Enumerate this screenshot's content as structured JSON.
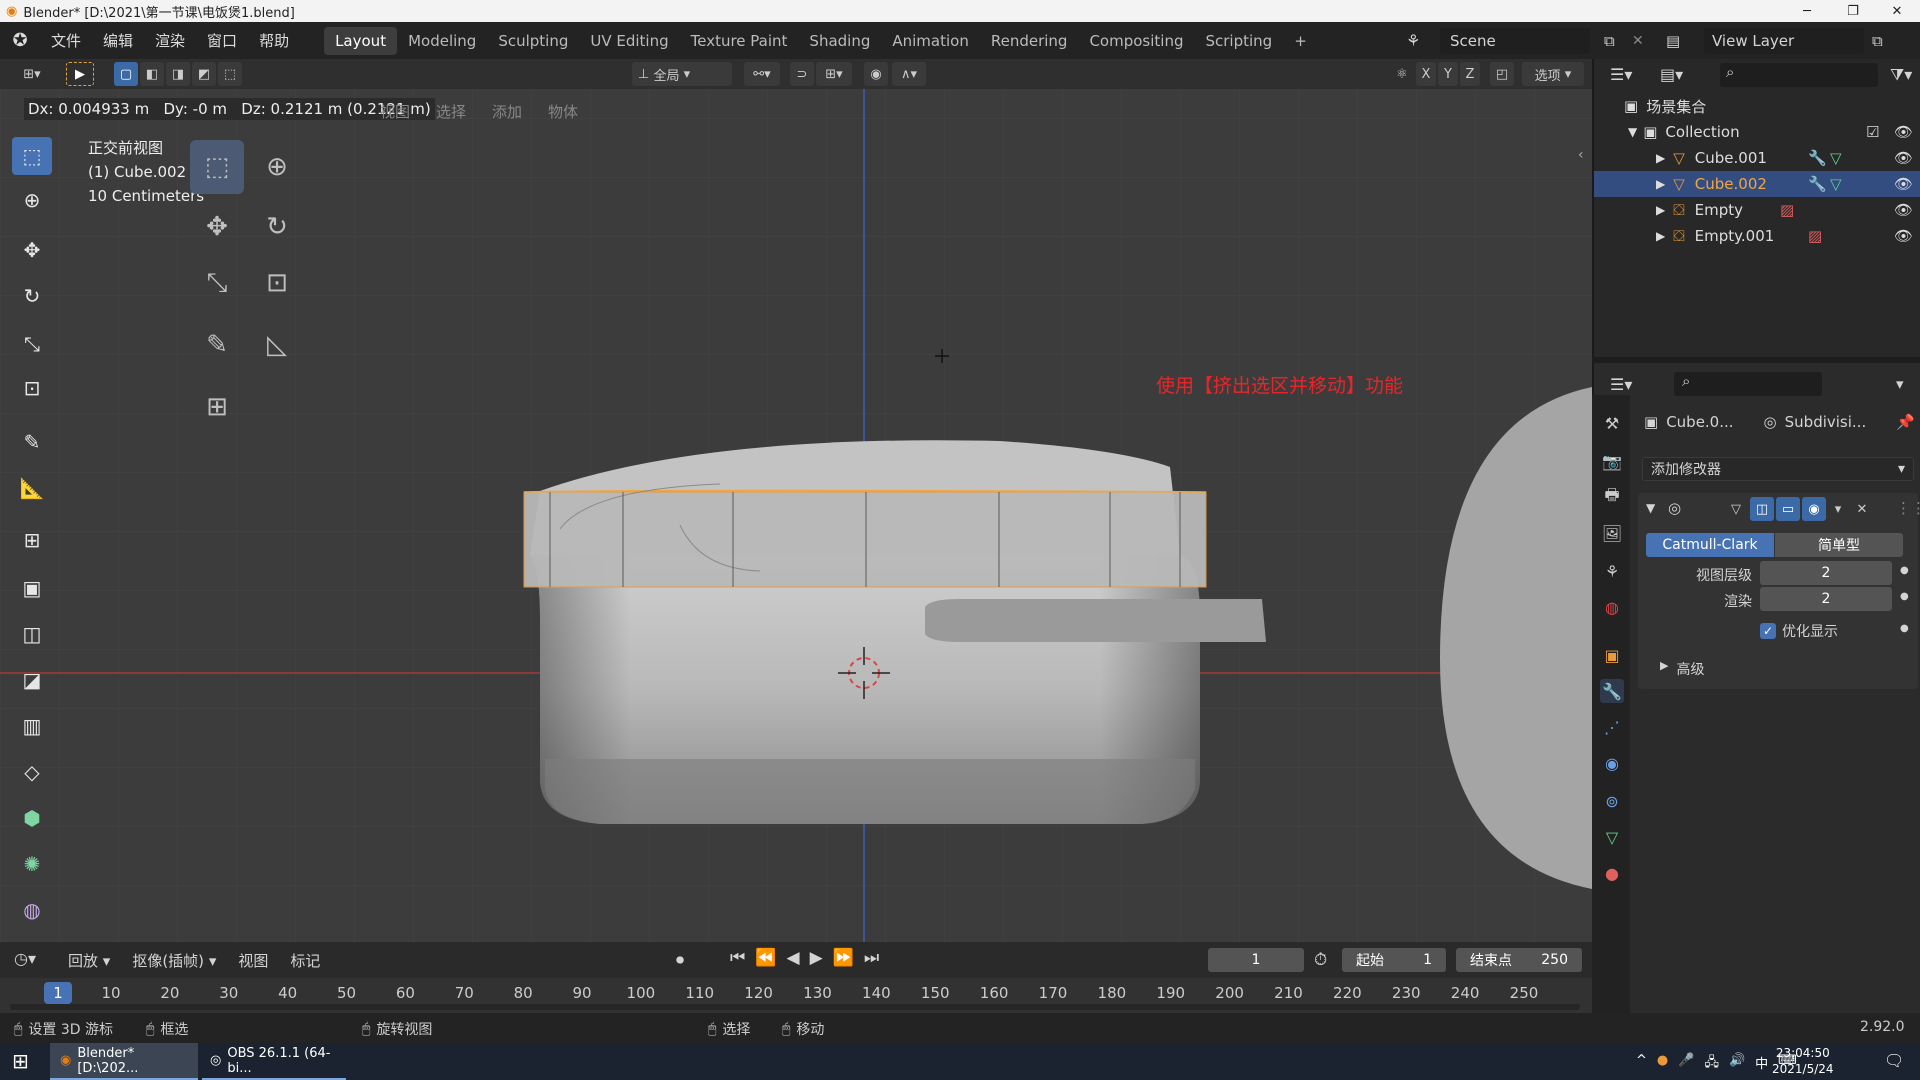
{
  "titlebar": {
    "title": "Blender* [D:\\2021\\第一节课\\电饭煲1.blend]",
    "minimize": "─",
    "restore": "❐",
    "close": "✕"
  },
  "menu": [
    "文件",
    "编辑",
    "渲染",
    "窗口",
    "帮助"
  ],
  "workspaces": [
    "Layout",
    "Modeling",
    "Sculpting",
    "UV Editing",
    "Texture Paint",
    "Shading",
    "Animation",
    "Rendering",
    "Compositing",
    "Scripting",
    "+"
  ],
  "scene": {
    "label": "Scene",
    "view_layer": "View Layer"
  },
  "viewport_header": {
    "transform_orientation": "全局",
    "options_label": "选项",
    "axes": [
      "X",
      "Y",
      "Z"
    ],
    "status_readout": "Dx: 0.004933 m   Dy: -0 m   Dz: 0.2121 m (0.2121 m)",
    "header_menus": [
      "视图",
      "选择",
      "添加",
      "物体"
    ]
  },
  "viewport_overlay": {
    "view_name": "正交前视图",
    "object_name": "(1) Cube.002",
    "scale": "10 Centimeters",
    "annotation": "使用【挤出选区并移动】功能",
    "annotation_color": "#e8262a"
  },
  "outliner": {
    "root": "场景集合",
    "collection": "Collection",
    "items": [
      {
        "name": "Cube.001",
        "selected": false
      },
      {
        "name": "Cube.002",
        "selected": true
      },
      {
        "name": "Empty",
        "selected": false
      },
      {
        "name": "Empty.001",
        "selected": false
      }
    ]
  },
  "properties": {
    "object_name": "Cube.0...",
    "modifier_name": "Subdivisi...",
    "add_modifier": "添加修改器",
    "subdiv_type_a": "Catmull-Clark",
    "subdiv_type_b": "简单型",
    "viewport_levels_label": "视图层级",
    "viewport_levels": "2",
    "render_label": "渲染",
    "render_levels": "2",
    "optimal_display": "优化显示",
    "advanced": "高级"
  },
  "timeline": {
    "menus": [
      "回放",
      "抠像(插帧)",
      "视图",
      "标记"
    ],
    "current_frame": "1",
    "start_label": "起始",
    "start": "1",
    "end_label": "结束点",
    "end": "250",
    "ticks": [
      "1",
      "10",
      "20",
      "30",
      "40",
      "50",
      "60",
      "70",
      "80",
      "90",
      "100",
      "110",
      "120",
      "130",
      "140",
      "150",
      "160",
      "170",
      "180",
      "190",
      "200",
      "210",
      "220",
      "230",
      "240",
      "250"
    ]
  },
  "statusbar": {
    "set_cursor": "设置 3D 游标",
    "box_select": "框选",
    "rotate_view": "旋转视图",
    "select": "选择",
    "move": "移动",
    "version": "2.92.0"
  },
  "taskbar": {
    "app1": "Blender* [D:\\202...",
    "app2": "OBS 26.1.1 (64-bi...",
    "time": "23:04:50",
    "date": "2021/5/24",
    "ime": "中"
  },
  "colors": {
    "accent": "#4772b3",
    "selected_row": "#334d80",
    "x_axis": "#b33a3a",
    "z_axis": "#3a5fb3"
  }
}
